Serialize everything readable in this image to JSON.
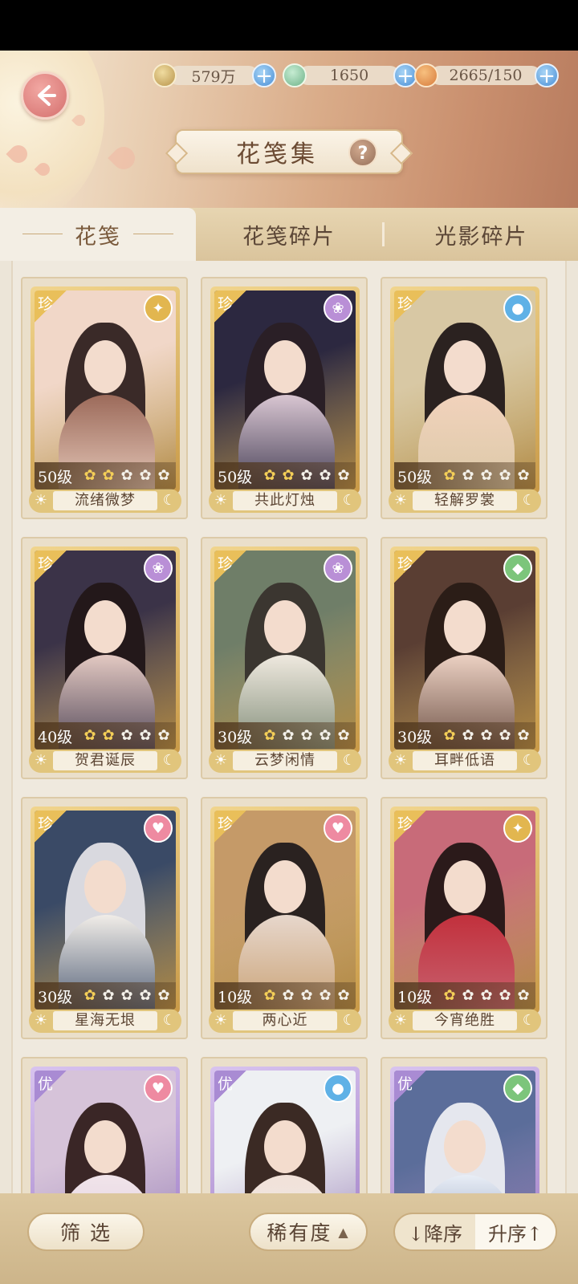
{
  "resources": [
    {
      "icon": "paw-coin-icon",
      "value": "579万"
    },
    {
      "icon": "jade-icon",
      "value": "1650"
    },
    {
      "icon": "mooncake-icon",
      "value": "2665/150"
    }
  ],
  "title": "花笺集",
  "help_label": "?",
  "tabs": [
    "花笺",
    "花笺碎片",
    "光影碎片"
  ],
  "cards": [
    {
      "rarity": "珍",
      "attribute": "gold-bird",
      "level": "50级",
      "stars": 2,
      "name": "流绪微梦"
    },
    {
      "rarity": "珍",
      "attribute": "purple-lotus",
      "level": "50级",
      "stars": 2,
      "name": "共此灯烛"
    },
    {
      "rarity": "珍",
      "attribute": "blue-water",
      "level": "50级",
      "stars": 1,
      "name": "轻解罗裳"
    },
    {
      "rarity": "珍",
      "attribute": "purple-lotus",
      "level": "40级",
      "stars": 2,
      "name": "贺君诞辰"
    },
    {
      "rarity": "珍",
      "attribute": "purple-lotus",
      "level": "30级",
      "stars": 1,
      "name": "云梦闲情"
    },
    {
      "rarity": "珍",
      "attribute": "green-leaf",
      "level": "30级",
      "stars": 1,
      "name": "耳畔低语"
    },
    {
      "rarity": "珍",
      "attribute": "pink-heart",
      "level": "30级",
      "stars": 1,
      "name": "星海无垠"
    },
    {
      "rarity": "珍",
      "attribute": "pink-heart",
      "level": "10级",
      "stars": 1,
      "name": "两心近"
    },
    {
      "rarity": "珍",
      "attribute": "gold-bird",
      "level": "10级",
      "stars": 1,
      "name": "今宵绝胜"
    },
    {
      "rarity": "优",
      "attribute": "pink-heart",
      "level": "",
      "stars": 0,
      "name": ""
    },
    {
      "rarity": "优",
      "attribute": "blue-water",
      "level": "",
      "stars": 0,
      "name": ""
    },
    {
      "rarity": "优",
      "attribute": "green-leaf",
      "level": "",
      "stars": 0,
      "name": ""
    }
  ],
  "footer": {
    "filter_label": "筛 选",
    "sort_by_label": "稀有度",
    "descending_label": "↓降序",
    "ascending_label": "升序↑"
  },
  "colors": {
    "gold-bird": "#e2b64f",
    "purple-lotus": "#b98fd6",
    "blue-water": "#5fb1e6",
    "green-leaf": "#7cc57b",
    "pink-heart": "#ee8aa1"
  }
}
